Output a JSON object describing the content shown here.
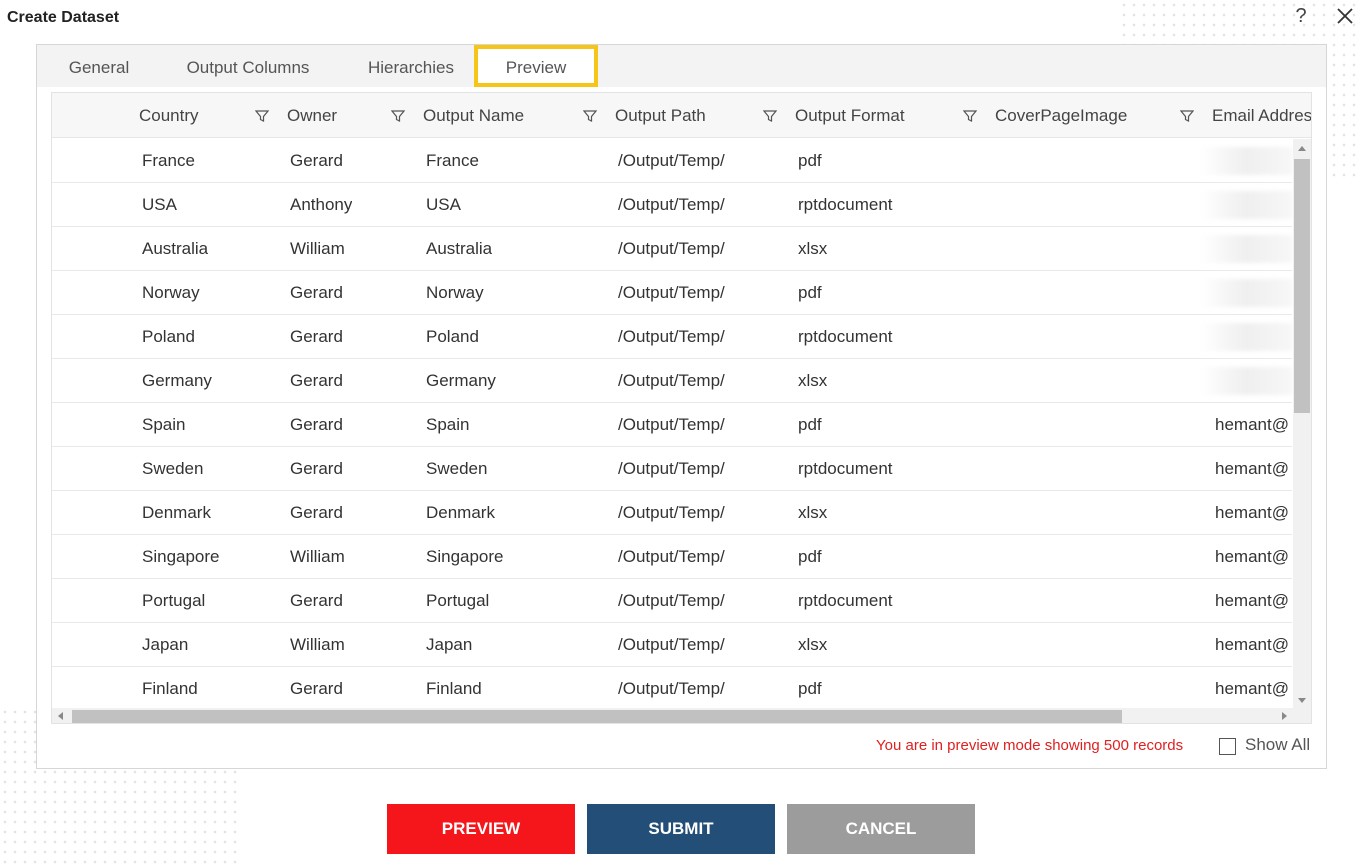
{
  "dialog": {
    "title": "Create Dataset",
    "help_glyph": "?"
  },
  "tabs": [
    {
      "label": "General",
      "active": false
    },
    {
      "label": "Output Columns",
      "active": false
    },
    {
      "label": "Hierarchies",
      "active": false
    },
    {
      "label": "Preview",
      "active": true
    }
  ],
  "grid": {
    "columns": [
      "Country",
      "Owner",
      "Output Name",
      "Output Path",
      "Output Format",
      "CoverPageImage",
      "Email Addres"
    ],
    "rows": [
      {
        "country": "France",
        "owner": "Gerard",
        "output_name": "France",
        "output_path": "/Output/Temp/",
        "output_format": "pdf",
        "cover_page_image": "",
        "email": ""
      },
      {
        "country": "USA",
        "owner": "Anthony",
        "output_name": "USA",
        "output_path": "/Output/Temp/",
        "output_format": "rptdocument",
        "cover_page_image": "",
        "email": ""
      },
      {
        "country": "Australia",
        "owner": "William",
        "output_name": "Australia",
        "output_path": "/Output/Temp/",
        "output_format": "xlsx",
        "cover_page_image": "",
        "email": ""
      },
      {
        "country": "Norway",
        "owner": "Gerard",
        "output_name": "Norway",
        "output_path": "/Output/Temp/",
        "output_format": "pdf",
        "cover_page_image": "",
        "email": ""
      },
      {
        "country": "Poland",
        "owner": "Gerard",
        "output_name": "Poland",
        "output_path": "/Output/Temp/",
        "output_format": "rptdocument",
        "cover_page_image": "",
        "email": ""
      },
      {
        "country": "Germany",
        "owner": "Gerard",
        "output_name": "Germany",
        "output_path": "/Output/Temp/",
        "output_format": "xlsx",
        "cover_page_image": "",
        "email": ""
      },
      {
        "country": "Spain",
        "owner": "Gerard",
        "output_name": "Spain",
        "output_path": "/Output/Temp/",
        "output_format": "pdf",
        "cover_page_image": "",
        "email": "hemant@"
      },
      {
        "country": "Sweden",
        "owner": "Gerard",
        "output_name": "Sweden",
        "output_path": "/Output/Temp/",
        "output_format": "rptdocument",
        "cover_page_image": "",
        "email": "hemant@"
      },
      {
        "country": "Denmark",
        "owner": "Gerard",
        "output_name": "Denmark",
        "output_path": "/Output/Temp/",
        "output_format": "xlsx",
        "cover_page_image": "",
        "email": "hemant@"
      },
      {
        "country": "Singapore",
        "owner": "William",
        "output_name": "Singapore",
        "output_path": "/Output/Temp/",
        "output_format": "pdf",
        "cover_page_image": "",
        "email": "hemant@"
      },
      {
        "country": "Portugal",
        "owner": "Gerard",
        "output_name": "Portugal",
        "output_path": "/Output/Temp/",
        "output_format": "rptdocument",
        "cover_page_image": "",
        "email": "hemant@"
      },
      {
        "country": "Japan",
        "owner": "William",
        "output_name": "Japan",
        "output_path": "/Output/Temp/",
        "output_format": "xlsx",
        "cover_page_image": "",
        "email": "hemant@"
      },
      {
        "country": "Finland",
        "owner": "Gerard",
        "output_name": "Finland",
        "output_path": "/Output/Temp/",
        "output_format": "pdf",
        "cover_page_image": "",
        "email": "hemant@"
      }
    ]
  },
  "footer": {
    "preview_note": "You are in preview mode showing 500 records",
    "show_all_label": "Show All",
    "show_all_checked": false
  },
  "buttons": {
    "preview": "PREVIEW",
    "submit": "SUBMIT",
    "cancel": "CANCEL"
  },
  "colors": {
    "active_tab_border": "#f5c518",
    "note_text": "#e02020",
    "preview_button": "#f4161a",
    "submit_button": "#224e77",
    "cancel_button": "#9c9c9c"
  }
}
